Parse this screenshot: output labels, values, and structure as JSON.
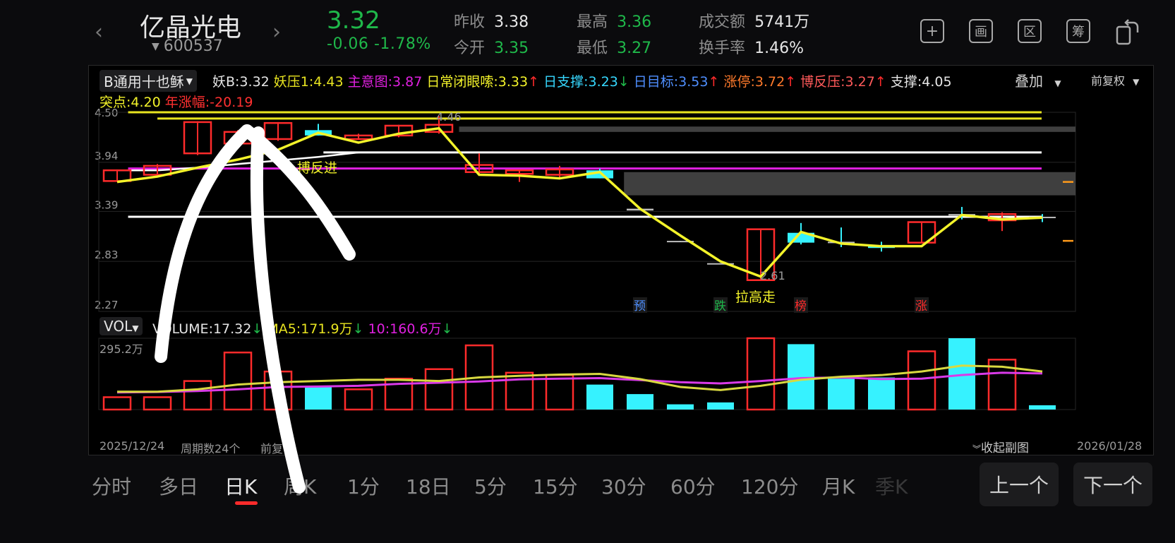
{
  "header": {
    "stock_name": "亿晶光电",
    "stock_code": "600537",
    "price": "3.32",
    "change": "-0.06",
    "change_pct": "-1.78%",
    "prev_close_label": "昨收",
    "prev_close": "3.38",
    "open_label": "今开",
    "open": "3.35",
    "high_label": "最高",
    "high": "3.36",
    "low_label": "最低",
    "low": "3.27",
    "turnover_amount_label": "成交额",
    "turnover_amount": "5741万",
    "turnover_rate_label": "换手率",
    "turnover_rate": "1.46%",
    "prev_arrow": "‹",
    "next_arrow": "›"
  },
  "toolbar": {
    "add_glyph": "+",
    "draw_glyph": "画",
    "range_glyph": "区",
    "chip_glyph": "筹"
  },
  "indicators": {
    "formula": "B通用十也稣",
    "yao_b": "妖B:3.32",
    "yao_ya": "妖压1:4.43",
    "zhu_yi": "主意图:3.87",
    "ri_chang": "日常闭眼嗦:3.33",
    "ri_zhi_cheng": "日支撑:3.23",
    "ri_mu_biao": "日目标:3.53",
    "zhang_ting": "涨停:3.72",
    "bo_fan_ya": "博反压:3.27",
    "zhi_cheng": "支撑:4.05",
    "overlay": "叠加",
    "adjust": "前复权",
    "tu_dian": "突点:4.20",
    "year_change": "年涨幅:-20.19"
  },
  "annotations": {
    "bo_fan_jin": "搏反进",
    "la_gao_zou": "拉高走",
    "peak": "4.46",
    "trough": "2.61",
    "yu": "预",
    "die": "跌",
    "bang": "榜",
    "zhang": "涨"
  },
  "volume": {
    "selector": "VOL",
    "volume_label": "VOLUME:17.32",
    "ma5_label": "MA5:171.9万",
    "ma10_label": "10:160.6万",
    "axis_max": "295.2万",
    "start_date": "2025/12/24",
    "period_count": "周期数24个",
    "adjust_short": "前复",
    "collapse": "收起副图",
    "end_date": "2026/01/28"
  },
  "tabs": [
    "分时",
    "多日",
    "日K",
    "周K",
    "1分",
    "18日",
    "5分",
    "15分",
    "30分",
    "60分",
    "120分",
    "月K",
    "季K"
  ],
  "nav": {
    "prev": "上一个",
    "next": "下一个"
  },
  "chart_data": {
    "type": "candlestick",
    "y_ticks": [
      "4.50",
      "3.94",
      "3.39",
      "2.83",
      "2.27"
    ],
    "ylim": [
      2.27,
      4.5
    ],
    "candles": [
      {
        "o": 3.85,
        "c": 3.73,
        "h": 3.86,
        "l": 3.72,
        "v": 52,
        "up": true
      },
      {
        "o": 3.8,
        "c": 3.9,
        "h": 3.92,
        "l": 3.78,
        "v": 52,
        "up": true
      },
      {
        "o": 4.04,
        "c": 4.39,
        "h": 4.4,
        "l": 4.02,
        "v": 120,
        "up": true
      },
      {
        "o": 4.15,
        "c": 4.28,
        "h": 4.3,
        "l": 4.14,
        "v": 240,
        "up": true
      },
      {
        "o": 4.2,
        "c": 4.38,
        "h": 4.39,
        "l": 4.18,
        "v": 160,
        "up": true
      },
      {
        "o": 4.24,
        "c": 4.3,
        "h": 4.37,
        "l": 4.24,
        "v": 95,
        "up": false
      },
      {
        "o": 4.2,
        "c": 4.24,
        "h": 4.26,
        "l": 4.19,
        "v": 85,
        "up": true
      },
      {
        "o": 4.24,
        "c": 4.35,
        "h": 4.36,
        "l": 4.22,
        "v": 130,
        "up": true
      },
      {
        "o": 4.28,
        "c": 4.36,
        "h": 4.46,
        "l": 4.26,
        "v": 170,
        "up": true
      },
      {
        "o": 3.83,
        "c": 3.91,
        "h": 4.04,
        "l": 3.8,
        "v": 270,
        "up": true
      },
      {
        "o": 3.81,
        "c": 3.85,
        "h": 3.86,
        "l": 3.72,
        "v": 155,
        "up": true
      },
      {
        "o": 3.8,
        "c": 3.86,
        "h": 3.9,
        "l": 3.77,
        "v": 145,
        "up": true
      },
      {
        "o": 3.85,
        "c": 3.76,
        "h": 3.87,
        "l": 3.76,
        "v": 105,
        "up": false
      },
      {
        "o": 3.42,
        "c": 3.4,
        "h": 3.42,
        "l": 3.4,
        "v": 65,
        "up": false
      },
      {
        "o": 3.06,
        "c": 3.05,
        "h": 3.06,
        "l": 3.05,
        "v": 22,
        "up": false
      },
      {
        "o": 2.81,
        "c": 2.8,
        "h": 2.81,
        "l": 2.8,
        "v": 30,
        "up": false
      },
      {
        "o": 2.62,
        "c": 3.19,
        "h": 3.19,
        "l": 2.61,
        "v": 300,
        "up": true
      },
      {
        "o": 3.15,
        "c": 3.04,
        "h": 3.26,
        "l": 3.02,
        "v": 275,
        "up": false
      },
      {
        "o": 3.05,
        "c": 3.04,
        "h": 3.21,
        "l": 2.99,
        "v": 130,
        "up": false
      },
      {
        "o": 3.01,
        "c": 2.98,
        "h": 3.05,
        "l": 2.94,
        "v": 135,
        "up": false
      },
      {
        "o": 3.04,
        "c": 3.27,
        "h": 3.27,
        "l": 3.04,
        "v": 245,
        "up": true
      },
      {
        "o": 3.35,
        "c": 3.36,
        "h": 3.44,
        "l": 3.3,
        "v": 300,
        "up": false
      },
      {
        "o": 3.29,
        "c": 3.36,
        "h": 3.38,
        "l": 3.17,
        "v": 210,
        "up": true
      },
      {
        "o": 3.33,
        "c": 3.32,
        "h": 3.36,
        "l": 3.27,
        "v": 18,
        "up": false
      }
    ],
    "line_price": [
      3.72,
      3.78,
      3.88,
      3.97,
      4.08,
      4.27,
      4.16,
      4.26,
      4.32,
      3.8,
      3.79,
      3.76,
      3.83,
      3.42,
      3.12,
      2.83,
      2.66,
      3.16,
      3.03,
      3.0,
      3.0,
      3.35,
      3.3,
      3.32
    ],
    "ma5_volume": [
      75,
      75,
      85,
      105,
      115,
      120,
      125,
      125,
      120,
      135,
      142,
      147,
      150,
      128,
      95,
      82,
      100,
      125,
      138,
      145,
      160,
      185,
      180,
      160
    ],
    "ma10_volume": [
      72,
      74,
      78,
      85,
      95,
      97,
      100,
      108,
      113,
      118,
      127,
      130,
      132,
      124,
      115,
      110,
      120,
      132,
      135,
      128,
      130,
      145,
      155,
      152
    ],
    "hlines": [
      {
        "y": 4.5,
        "color": "#e8e420",
        "from": 0.03
      },
      {
        "y": 4.43,
        "color": "#e8e420",
        "from": 0.06
      },
      {
        "y": 4.05,
        "color": "#ffffff",
        "from": 0.23
      },
      {
        "y": 3.87,
        "color": "#e020e0",
        "from": 0.03
      },
      {
        "y": 3.33,
        "color": "#ffffff",
        "from": 0.03
      }
    ],
    "step_line_support": [
      3.85,
      3.85,
      3.88,
      3.92,
      3.96,
      4.0,
      4.05
    ],
    "shade_zones": [
      {
        "from_idx": 8.5,
        "y_top": 4.34,
        "y_bot": 4.28
      },
      {
        "from_idx": 12.6,
        "y_top": 3.83,
        "y_bot": 3.57
      }
    ],
    "colors": {
      "up": "#ff2b2b",
      "down": "#36f2ff",
      "price_line": "#f3f32a",
      "ma10": "#d93ae8",
      "ma5": "#d8d840"
    }
  }
}
